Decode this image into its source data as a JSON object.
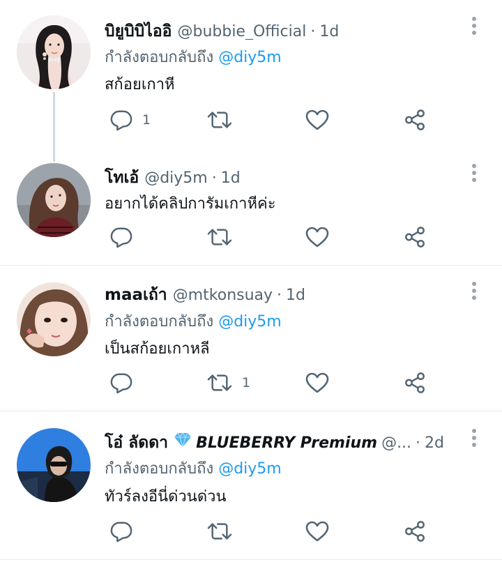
{
  "tweets": [
    {
      "name": "บิยูบิบิไออิ",
      "handle": "@bubbie_Official",
      "separator": "·",
      "time": "1d",
      "replying_prefix": "กำลังตอบกลับถึง",
      "replying_to": "@diy5m",
      "text": "สก้อยเกาหี",
      "reply_count": "1",
      "retweet_count": "",
      "avatar_icon": "profile-photo"
    },
    {
      "name": "โทเอ้",
      "handle": "@diy5m",
      "separator": "·",
      "time": "1d",
      "text": "อยากได้คลิปการัมเกาหีค่ะ",
      "reply_count": "",
      "retweet_count": "",
      "avatar_icon": "profile-photo"
    },
    {
      "name": "maaเถ้า",
      "handle": "@mtkonsuay",
      "separator": "·",
      "time": "1d",
      "replying_prefix": "กำลังตอบกลับถึง",
      "replying_to": "@diy5m",
      "text": "เป็นสก้อยเกาหลี",
      "reply_count": "",
      "retweet_count": "1",
      "avatar_icon": "profile-photo"
    },
    {
      "name": "โอ๋ ลัดดา",
      "badge_icon": "diamond-emoji",
      "badge_text": "BLUEBERRY Premium",
      "handle": "@...",
      "separator": "·",
      "time": "2d",
      "replying_prefix": "กำลังตอบกลับถึง",
      "replying_to": "@diy5m",
      "text": "ทัวร์ลงอีนี่ด่วนด่วน",
      "reply_count": "",
      "retweet_count": "",
      "avatar_icon": "profile-photo"
    }
  ],
  "icons": {
    "reply": "reply-icon",
    "retweet": "retweet-icon",
    "like": "heart-icon",
    "share": "share-icon",
    "more": "more-vertical-icon"
  },
  "colors": {
    "text": "#0f1419",
    "secondary": "#536471",
    "link": "#1d9bf0",
    "divider": "#e6e9ec",
    "thread_line": "#cfd9de",
    "gem": "#4fb3f0"
  }
}
